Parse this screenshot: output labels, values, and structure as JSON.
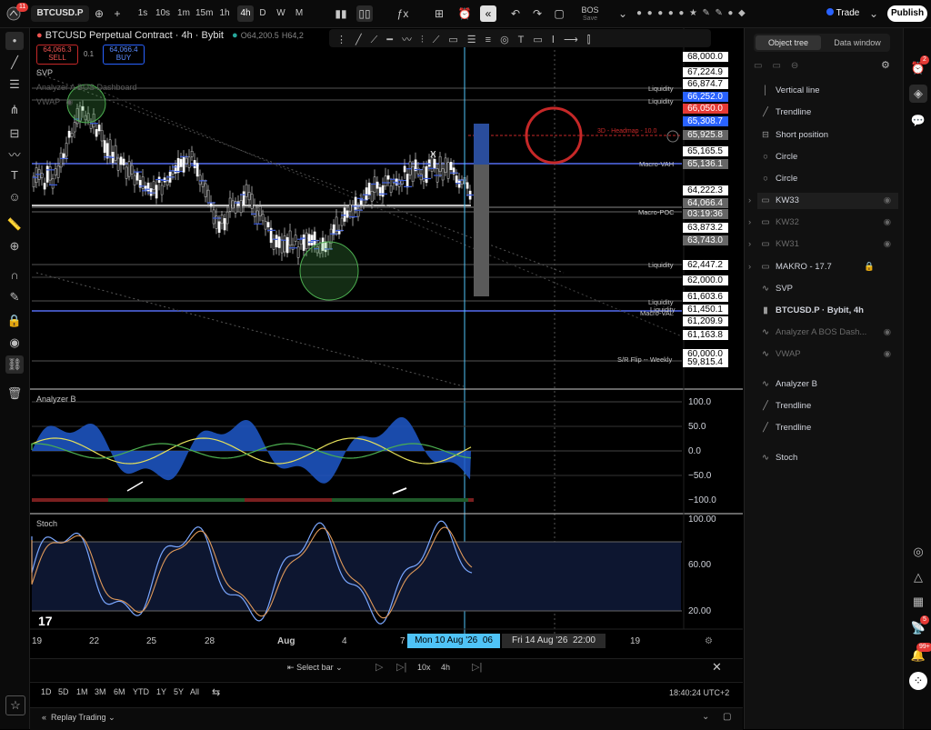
{
  "topbar": {
    "symbol": "BTCUSD.P",
    "intervals": [
      "1s",
      "10s",
      "1m",
      "15m",
      "1h",
      "4h",
      "D",
      "W",
      "M"
    ],
    "active_interval": "4h",
    "bos_label": "BOS",
    "save_label": "Save",
    "trade_label": "Trade",
    "publish_label": "Publish",
    "avatar_badge": "11"
  },
  "legend": {
    "title": "BTCUSD Perpetual Contract · 4h · Bybit",
    "ohlc_fragment": "O64,200.5",
    "ohlc_fragment2": "H64,2",
    "sell_price": "64,066.3",
    "sell_label": "SELL",
    "spread": "0.1",
    "buy_price": "64,066.4",
    "buy_label": "BUY",
    "indicators": [
      "SVP",
      "Analyzer A BOS Dashboard",
      "VWAP"
    ]
  },
  "main_chart": {
    "price_labels": [
      {
        "value": "68,000.0",
        "style": "box"
      },
      {
        "value": "67,224.9",
        "style": "box"
      },
      {
        "value": "66,874.7",
        "style": "box"
      },
      {
        "value": "66,252.0",
        "style": "blue"
      },
      {
        "value": "66,050.0",
        "style": "red"
      },
      {
        "value": "65,308.7",
        "style": "blue"
      },
      {
        "value": "65,925.8",
        "style": "gray"
      },
      {
        "value": "65,165.5",
        "style": "box"
      },
      {
        "value": "65,136.1",
        "style": "gray"
      },
      {
        "value": "64,222.3",
        "style": "box"
      },
      {
        "value": "64,066.4",
        "style": "gray"
      },
      {
        "value": "03:19:36",
        "style": "gray"
      },
      {
        "value": "63,873.2",
        "style": "box"
      },
      {
        "value": "63,743.0",
        "style": "gray"
      },
      {
        "value": "62,447.2",
        "style": "box"
      },
      {
        "value": "62,000.0",
        "style": "box"
      },
      {
        "value": "61,603.6",
        "style": "box"
      },
      {
        "value": "61,450.1",
        "style": "box"
      },
      {
        "value": "61,209.9",
        "style": "box"
      },
      {
        "value": "61,163.8",
        "style": "box"
      },
      {
        "value": "60,000.0",
        "style": "box"
      },
      {
        "value": "59,815.4",
        "style": "box"
      }
    ],
    "side_labels": [
      "Liquidity",
      "Liquidity",
      "Macro-VAH",
      "Macro-POC",
      "Liquidity",
      "Liquidity",
      "Liquidity",
      "Macro-VAL",
      "S/R Flip -- Weekly"
    ],
    "headmap_label": "3D - Headmap - 10.0",
    "x_marker": "X"
  },
  "analyzer": {
    "title": "Analyzer B",
    "scale": [
      "100.0",
      "50.0",
      "0.0",
      "−50.0",
      "−100.0"
    ]
  },
  "stoch": {
    "title": "Stoch",
    "scale": [
      "100.00",
      "60.00",
      "20.00"
    ]
  },
  "time_axis": {
    "labels": [
      "19",
      "22",
      "25",
      "28",
      "Aug",
      "4",
      "7",
      "19"
    ],
    "crosshair_date": "Mon 10 Aug '26",
    "crosshair_time": "06",
    "range_end": "Fri 14 Aug '26",
    "range_time": "22:00"
  },
  "replay": {
    "select_bar": "Select bar",
    "speed": "10x",
    "interval": "4h"
  },
  "bottom": {
    "ranges": [
      "1D",
      "5D",
      "1M",
      "3M",
      "6M",
      "YTD",
      "1Y",
      "5Y",
      "All"
    ],
    "clock": "18:40:24 UTC+2",
    "replay_trading": "Replay Trading"
  },
  "object_tree": {
    "tabs": [
      "Object tree",
      "Data window"
    ],
    "items": [
      {
        "label": "Vertical line",
        "icon": "vertical-line-icon",
        "dim": false,
        "group": false
      },
      {
        "label": "Trendline",
        "icon": "trendline-icon",
        "dim": false,
        "group": false
      },
      {
        "label": "Short position",
        "icon": "short-position-icon",
        "dim": false,
        "group": false
      },
      {
        "label": "Circle",
        "icon": "circle-icon",
        "dim": false,
        "group": false
      },
      {
        "label": "Circle",
        "icon": "circle-icon",
        "dim": false,
        "group": false
      },
      {
        "label": "KW33",
        "icon": "folder-icon",
        "dim": false,
        "group": true
      },
      {
        "label": "KW32",
        "icon": "folder-icon",
        "dim": true,
        "group": true
      },
      {
        "label": "KW31",
        "icon": "folder-icon",
        "dim": true,
        "group": true
      },
      {
        "label": "MAKRO - 17.7",
        "icon": "folder-icon",
        "dim": false,
        "group": true
      },
      {
        "label": "SVP",
        "icon": "indicator-icon",
        "dim": false,
        "group": false
      },
      {
        "label": "BTCUSD.P · Bybit, 4h",
        "icon": "series-icon",
        "dim": false,
        "group": false
      },
      {
        "label": "Analyzer A BOS Dash...",
        "icon": "indicator-icon",
        "dim": true,
        "group": false
      },
      {
        "label": "VWAP",
        "icon": "indicator-icon",
        "dim": true,
        "group": false
      },
      {
        "label": "Analyzer B",
        "icon": "indicator-icon",
        "dim": false,
        "group": false
      },
      {
        "label": "Trendline",
        "icon": "trendline-icon",
        "dim": false,
        "group": false
      },
      {
        "label": "Trendline",
        "icon": "trendline-icon",
        "dim": false,
        "group": false
      },
      {
        "label": "Stoch",
        "icon": "indicator-icon",
        "dim": false,
        "group": false
      }
    ]
  },
  "rightbar": {
    "alerts_badge": "2",
    "notif_badge": "5",
    "news_badge": "99+"
  },
  "colors": {
    "accent_blue": "#2962ff",
    "bear": "#ef5350",
    "bull": "#26a69a",
    "crosshair": "#4fc3f7"
  }
}
